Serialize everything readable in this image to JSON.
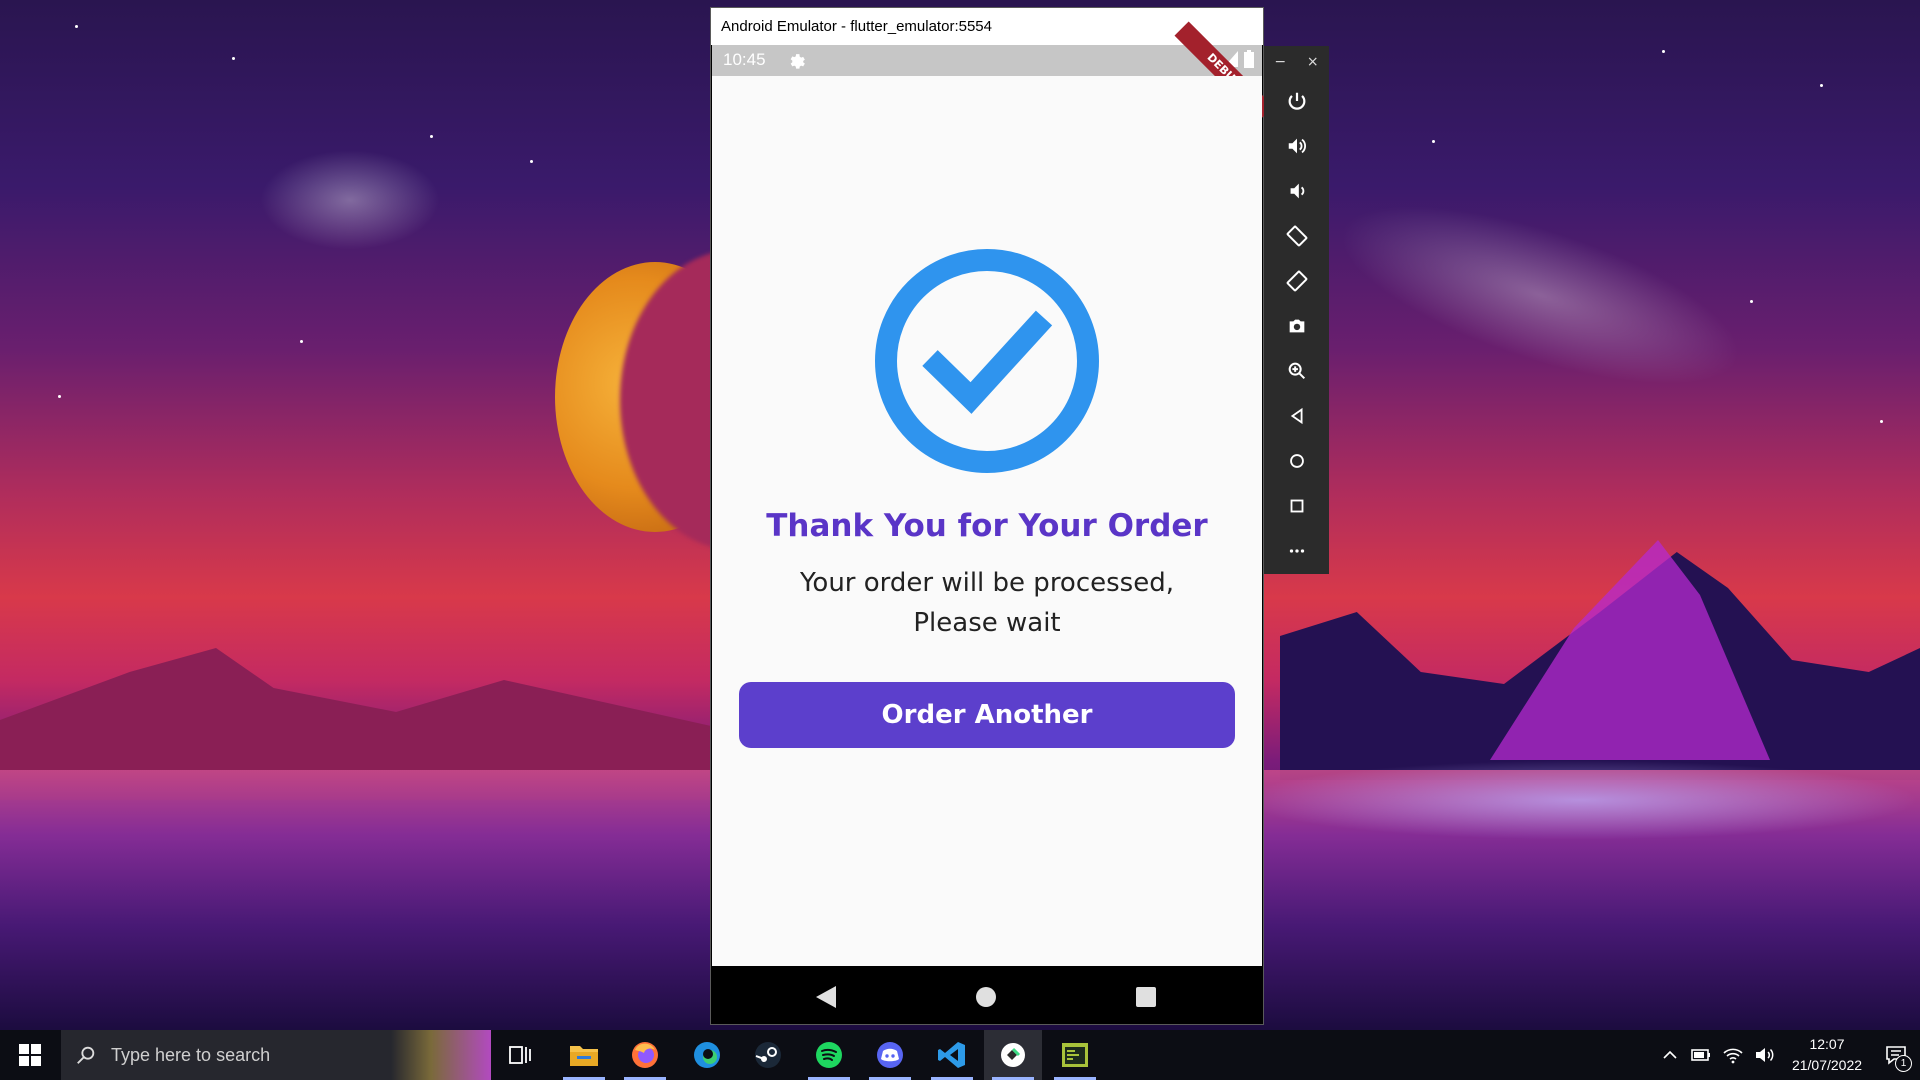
{
  "window": {
    "title": "Android Emulator - flutter_emulator:5554"
  },
  "statusbar": {
    "time": "10:45",
    "debug_banner": "DEBUG"
  },
  "app": {
    "heading": "Thank You for Your Order",
    "message_line1": "Your order will be processed,",
    "message_line2": "Please wait",
    "button_label": "Order Another",
    "accent_color": "#5c3fcc",
    "check_color": "#2f94ee"
  },
  "toolbar": {
    "minimize": "−",
    "close": "×",
    "buttons": [
      "power-icon",
      "volume-up-icon",
      "volume-down-icon",
      "rotate-left-icon",
      "rotate-right-icon",
      "camera-icon",
      "zoom-icon",
      "back-icon",
      "home-icon",
      "overview-icon",
      "more-icon"
    ]
  },
  "taskbar": {
    "search_placeholder": "Type here to search",
    "apps": [
      "task-view-icon",
      "file-explorer-icon",
      "firefox-icon",
      "edge-icon",
      "steam-icon",
      "spotify-icon",
      "discord-icon",
      "vscode-icon",
      "emulator-icon",
      "terminal-icon"
    ],
    "clock_time": "12:07",
    "clock_date": "21/07/2022",
    "notification_count": "1"
  }
}
